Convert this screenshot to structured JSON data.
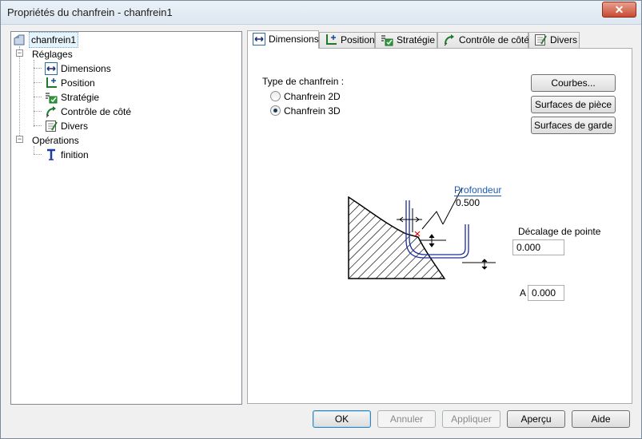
{
  "window": {
    "title": "Propriétés du chanfrein - chanfrein1",
    "close_glyph": "✕"
  },
  "tree": {
    "root": "chanfrein1",
    "reglages": "Réglages",
    "reglages_items": [
      "Dimensions",
      "Position",
      "Stratégie",
      "Contrôle de côté",
      "Divers"
    ],
    "operations": "Opérations",
    "operations_items": [
      "finition"
    ]
  },
  "tabs": [
    "Dimensions",
    "Position",
    "Stratégie",
    "Contrôle de côté",
    "Divers"
  ],
  "panel": {
    "type_label": "Type de chanfrein :",
    "radio_2d": "Chanfrein 2D",
    "radio_3d": "Chanfrein 3D",
    "selected": "Chanfrein 3D",
    "btn_courbes": "Courbes...",
    "btn_surfaces_piece": "Surfaces de pièce",
    "btn_surfaces_garde": "Surfaces de garde",
    "profondeur_label": "Profondeur",
    "profondeur_value": "0.500",
    "decalage_label": "Décalage de pointe",
    "decalage_value": "0.000",
    "a_label": "A",
    "a_value": "0.000"
  },
  "footer": {
    "ok": "OK",
    "annuler": "Annuler",
    "appliquer": "Appliquer",
    "apercu": "Aperçu",
    "aide": "Aide"
  },
  "colors": {
    "accent": "#3c7fb1",
    "link": "#1e5bb4",
    "strategy_green": "#2e9e3a"
  }
}
